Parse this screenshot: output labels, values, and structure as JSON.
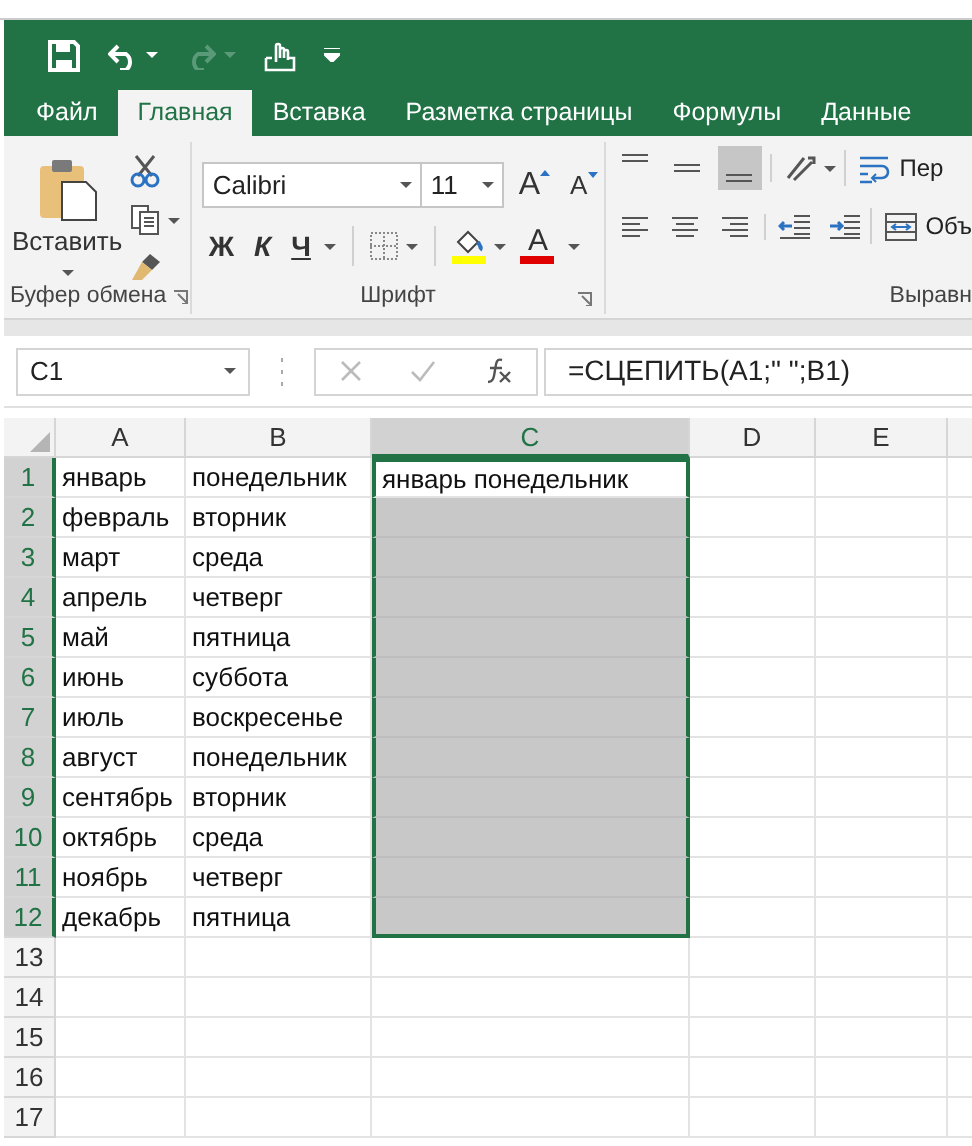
{
  "tabs": [
    {
      "label": "Файл",
      "selected": false
    },
    {
      "label": "Главная",
      "selected": true
    },
    {
      "label": "Вставка",
      "selected": false
    },
    {
      "label": "Разметка страницы",
      "selected": false
    },
    {
      "label": "Формулы",
      "selected": false
    },
    {
      "label": "Данные",
      "selected": false
    }
  ],
  "ribbon": {
    "clipboard": {
      "paste_label": "Вставить",
      "group_label": "Буфер обмена"
    },
    "font": {
      "font_name": "Calibri",
      "font_size": "11",
      "grow_glyph": "A",
      "shrink_glyph": "A",
      "bold": "Ж",
      "italic": "К",
      "underline": "Ч",
      "font_color_glyph": "A",
      "group_label": "Шрифт"
    },
    "alignment": {
      "vertical": [
        {
          "selected": false
        },
        {
          "selected": false
        },
        {
          "selected": true
        }
      ],
      "wrap_label": "Пер",
      "merge_label": "Объ",
      "group_label": "Выравн"
    }
  },
  "formula_bar": {
    "name_box": "C1",
    "formula": "=СЦЕПИТЬ(A1;\" \";B1)"
  },
  "sheet": {
    "columns": [
      {
        "label": "A",
        "selected": false
      },
      {
        "label": "B",
        "selected": false
      },
      {
        "label": "C",
        "selected": true
      },
      {
        "label": "D",
        "selected": false
      },
      {
        "label": "E",
        "selected": false
      }
    ],
    "rows": [
      {
        "number": "1",
        "selected": true,
        "active": true,
        "cells": [
          "январь",
          "понедельник",
          "январь понедельник"
        ]
      },
      {
        "number": "2",
        "selected": true,
        "active": false,
        "cells": [
          "февраль",
          "вторник"
        ]
      },
      {
        "number": "3",
        "selected": true,
        "active": false,
        "cells": [
          "март",
          "среда"
        ]
      },
      {
        "number": "4",
        "selected": true,
        "active": false,
        "cells": [
          "апрель",
          "четверг"
        ]
      },
      {
        "number": "5",
        "selected": true,
        "active": false,
        "cells": [
          "май",
          "пятница"
        ]
      },
      {
        "number": "6",
        "selected": true,
        "active": false,
        "cells": [
          "июнь",
          "суббота"
        ]
      },
      {
        "number": "7",
        "selected": true,
        "active": false,
        "cells": [
          "июль",
          "воскресенье"
        ]
      },
      {
        "number": "8",
        "selected": true,
        "active": false,
        "cells": [
          "август",
          "понедельник"
        ]
      },
      {
        "number": "9",
        "selected": true,
        "active": false,
        "cells": [
          "сентябрь",
          "вторник"
        ]
      },
      {
        "number": "10",
        "selected": true,
        "active": false,
        "cells": [
          "октябрь",
          "среда"
        ]
      },
      {
        "number": "11",
        "selected": true,
        "active": false,
        "cells": [
          "ноябрь",
          "четверг"
        ]
      },
      {
        "number": "12",
        "selected": true,
        "active": false,
        "cells": [
          "декабрь",
          "пятница"
        ]
      },
      {
        "number": "13",
        "selected": false,
        "active": false,
        "cells": []
      },
      {
        "number": "14",
        "selected": false,
        "active": false,
        "cells": []
      },
      {
        "number": "15",
        "selected": false,
        "active": false,
        "cells": []
      },
      {
        "number": "16",
        "selected": false,
        "active": false,
        "cells": []
      },
      {
        "number": "17",
        "selected": false,
        "active": false,
        "cells": []
      }
    ]
  }
}
